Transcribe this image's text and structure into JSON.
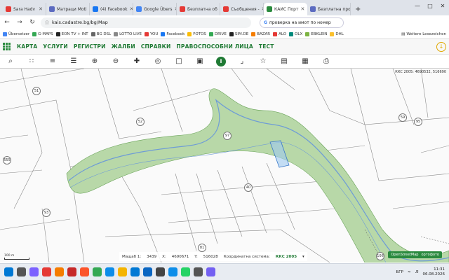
{
  "browser": {
    "tabs": [
      {
        "label": "Sara Hadv",
        "color": "#e53935"
      },
      {
        "label": "Матраци Moti",
        "color": "#5c6bc0"
      },
      {
        "label": "(4) Facebook",
        "color": "#1877f2"
      },
      {
        "label": "Google Übers",
        "color": "#4285f4"
      },
      {
        "label": "Безплатна об",
        "color": "#e53935"
      },
      {
        "label": "Съобщения -",
        "color": "#e53935"
      },
      {
        "label": "КАИС Порт",
        "color": "#2a8a3e"
      },
      {
        "label": "Безплатна про",
        "color": "#5c6bc0"
      }
    ],
    "new_tab": "+",
    "window_controls": [
      "—",
      "□",
      "✕"
    ],
    "url": "kais.cadastre.bg/bg/Map",
    "search_text": "проверка на имот по номер",
    "nav": {
      "back": "←",
      "forward": "→",
      "reload": "↻"
    }
  },
  "bookmarks": [
    {
      "label": "Übersetzer",
      "color": "#4285f4"
    },
    {
      "label": "G-MAPS",
      "color": "#34a853"
    },
    {
      "label": "EON TV + INT",
      "color": "#222"
    },
    {
      "label": "BG DSL",
      "color": "#666"
    },
    {
      "label": "LOTTO LIVE",
      "color": "#888"
    },
    {
      "label": "YOU",
      "color": "#e53935"
    },
    {
      "label": "Facebook",
      "color": "#1877f2"
    },
    {
      "label": "FOTOS",
      "color": "#fbbc05"
    },
    {
      "label": "DRIVE",
      "color": "#34a853"
    },
    {
      "label": "SIM.DE",
      "color": "#222"
    },
    {
      "label": "BAZAR",
      "color": "#f57c00"
    },
    {
      "label": "ALO",
      "color": "#e53935"
    },
    {
      "label": "OLX",
      "color": "#00897b"
    },
    {
      "label": "EBKLEIN",
      "color": "#7cb342"
    },
    {
      "label": "DHL",
      "color": "#fbc02d"
    }
  ],
  "bookmarks_more": "Weitere Lesezeichen",
  "app_menu": [
    "КАРТА",
    "УСЛУГИ",
    "РЕГИСТРИ",
    "ЖАЛБИ",
    "СПРАВКИ",
    "ПРАВОСПОСОБНИ ЛИЦА",
    "ТЕСТ"
  ],
  "download_icon": "↓",
  "map_tools": [
    {
      "name": "search-icon",
      "glyph": "⌕"
    },
    {
      "name": "nodes-icon",
      "glyph": "∷"
    },
    {
      "name": "layers-icon",
      "glyph": "≡"
    },
    {
      "name": "stack-icon",
      "glyph": "☰"
    },
    {
      "name": "zoom-in-icon",
      "glyph": "⊕"
    },
    {
      "name": "zoom-out-icon",
      "glyph": "⊖"
    },
    {
      "name": "pan-icon",
      "glyph": "✚"
    },
    {
      "name": "pin-icon",
      "glyph": "◎"
    },
    {
      "name": "select-rect-icon",
      "glyph": "□"
    },
    {
      "name": "select-area-icon",
      "glyph": "▣"
    },
    {
      "name": "info-icon",
      "glyph": "i"
    },
    {
      "name": "measure-line-icon",
      "glyph": "⌟"
    },
    {
      "name": "measure-area-icon",
      "glyph": "☆"
    },
    {
      "name": "book-icon",
      "glyph": "▤"
    },
    {
      "name": "table-icon",
      "glyph": "▦"
    },
    {
      "name": "print-icon",
      "glyph": "⎙"
    }
  ],
  "map": {
    "top_coords": "ККС 2005: 4690532, 516690",
    "parcels": [
      "51",
      "52",
      "97",
      "95",
      "40",
      "93",
      "555",
      "59",
      "81",
      "106"
    ],
    "scale_label": "100 m",
    "river_color": "#6e9cd6",
    "forest_color": "#b8d8a8",
    "highlight_color": "#9ec9f0"
  },
  "status": {
    "scale_label": "Мащаб 1:",
    "scale_value": "3439",
    "x_label": "X:",
    "x_value": "4690671",
    "y_label": "Y:",
    "y_value": "516028",
    "crs_label": "Координатна система:",
    "crs_value": "ККС 2005",
    "osm_label": "OpenStreetMap",
    "orto_label": "ортофото"
  },
  "taskbar": {
    "apps": [
      {
        "name": "windows-start-icon",
        "color": "#0078d4"
      },
      {
        "name": "search-taskbar-icon",
        "color": "#555"
      },
      {
        "name": "copilot-icon",
        "color": "#7b61ff"
      },
      {
        "name": "opera-icon",
        "color": "#e53935"
      },
      {
        "name": "firefox-icon",
        "color": "#f57c00"
      },
      {
        "name": "vivaldi-icon",
        "color": "#c62828"
      },
      {
        "name": "brave-icon",
        "color": "#fb542b"
      },
      {
        "name": "chrome-icon",
        "color": "#34a853"
      },
      {
        "name": "edge-icon",
        "color": "#0c8ce9"
      },
      {
        "name": "explorer-icon",
        "color": "#f4b400"
      },
      {
        "name": "photos-icon",
        "color": "#0078d4"
      },
      {
        "name": "mail-icon",
        "color": "#0a66c2"
      },
      {
        "name": "store-icon",
        "color": "#444"
      },
      {
        "name": "teamviewer-icon",
        "color": "#0e8ee9"
      },
      {
        "name": "whatsapp-icon",
        "color": "#25d366"
      },
      {
        "name": "settings-icon",
        "color": "#555"
      },
      {
        "name": "viber-icon",
        "color": "#7360f2"
      }
    ],
    "language": "БГР",
    "time": "11:31",
    "date": "06.08.2026"
  }
}
